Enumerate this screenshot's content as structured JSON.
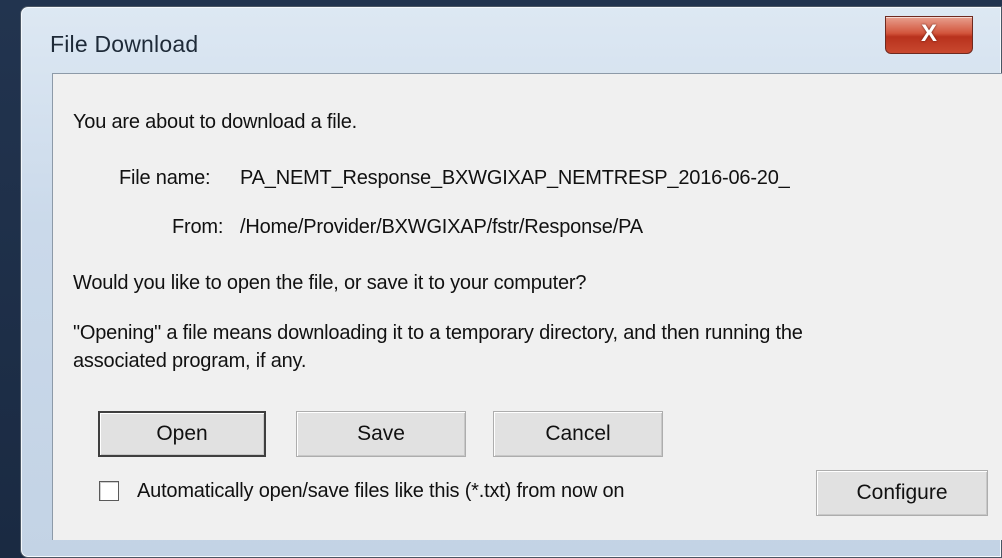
{
  "window": {
    "title": "File Download",
    "close_glyph": "X"
  },
  "message": {
    "intro": "You are about to download a file.",
    "file_name_label": "File name:",
    "file_name_value": "PA_NEMT_Response_BXWGIXAP_NEMTRESP_2016-06-20_",
    "from_label": "From:",
    "from_value": "/Home/Provider/BXWGIXAP/fstr/Response/PA",
    "question": "Would you like to open the file, or save it to your computer?",
    "explanation_line1": "\"Opening\" a file means downloading it to a temporary directory, and then running the",
    "explanation_line2": "associated program, if any."
  },
  "buttons": {
    "open": "Open",
    "save": "Save",
    "cancel": "Cancel",
    "configure": "Configure"
  },
  "auto_option": {
    "label": "Automatically open/save files like this (*.txt) from now on",
    "checked": false
  },
  "colors": {
    "close_button": "#c9482f",
    "dialog_background": "#f0f0f0",
    "frame": "#cad9ea"
  }
}
